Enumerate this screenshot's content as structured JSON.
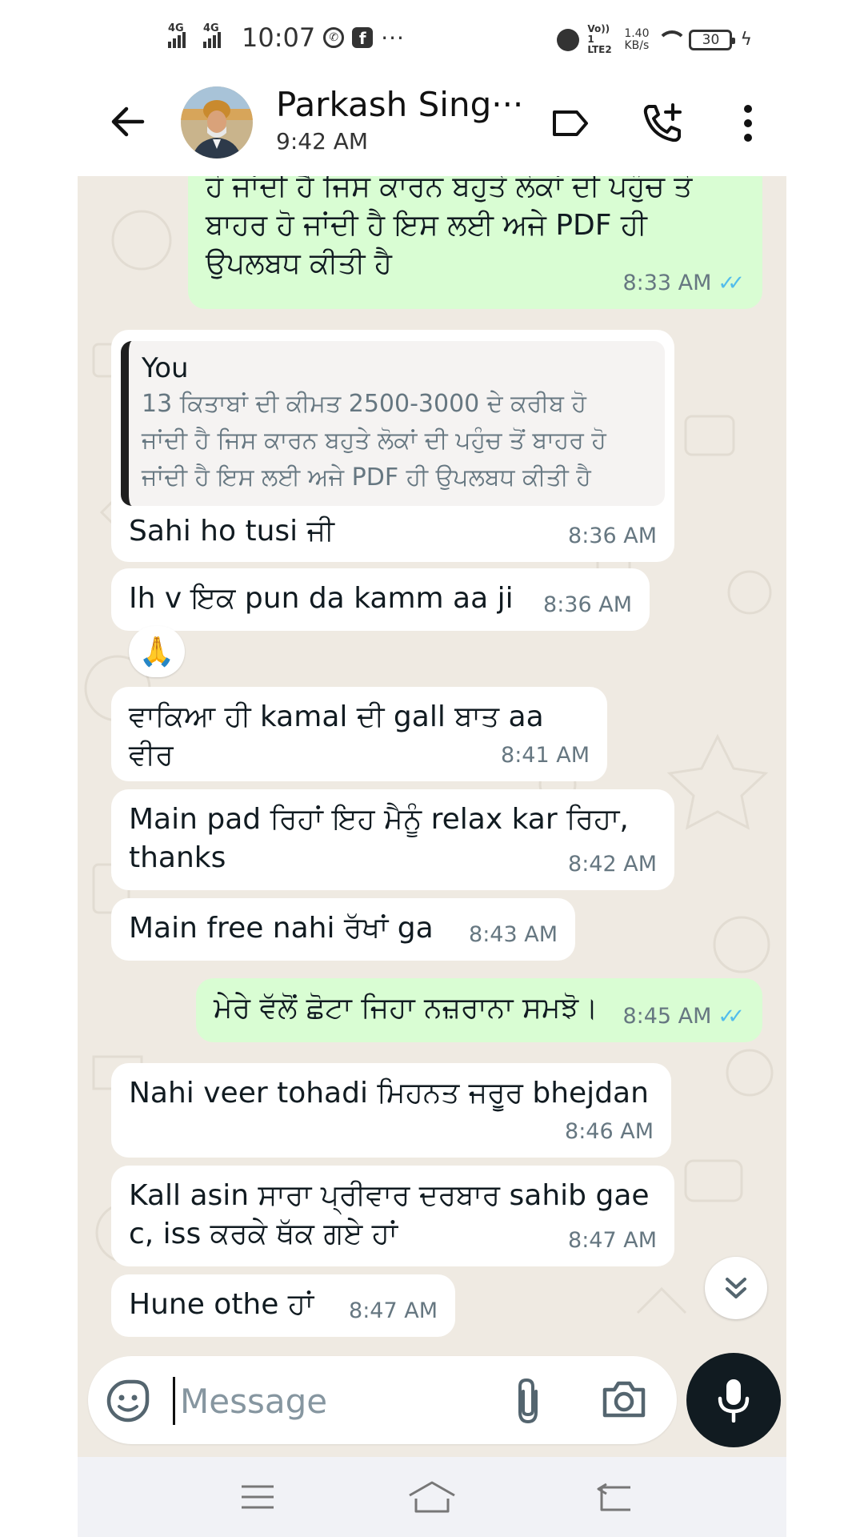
{
  "status_bar": {
    "network_1": "4G",
    "network_2": "4G",
    "time": "10:07",
    "volte": "Vo)) 1 LTE2",
    "speed_value": "1.40",
    "speed_unit": "KB/s",
    "battery": "30"
  },
  "header": {
    "contact_name": "Parkash Sing···",
    "last_seen": "9:42 AM"
  },
  "messages": [
    {
      "direction": "out",
      "text_lines": [
        "ਹੋ ਜਾਂਦੀ ਹੈ ਜਿਸ ਕਾਰਨ ਬਹੁਤੇ ਲੋਕਾਂ ਦੀ ਪਹੁੰਚ ਤੋ",
        "ਬਾਹਰ ਹੋ ਜਾਂਦੀ ਹੈ ਇਸ ਲਈ ਅਜੇ PDF ਹੀ",
        "ਉਪਲਬਧ ਕੀਤੀ ਹੈ"
      ],
      "time": "8:33 AM",
      "read": true
    },
    {
      "direction": "in",
      "quote_author": "You",
      "quote_lines": [
        "13 ਕਿਤਾਬਾਂ ਦੀ ਕੀਮਤ 2500-3000 ਦੇ ਕਰੀਬ ਹੋ",
        "ਜਾਂਦੀ ਹੈ ਜਿਸ ਕਾਰਨ ਬਹੁਤੇ ਲੋਕਾਂ ਦੀ ਪਹੁੰਚ ਤੋਂ ਬਾਹਰ ਹੋ",
        "ਜਾਂਦੀ ਹੈ ਇਸ ਲਈ ਅਜੇ PDF ਹੀ ਉਪਲਬਧ ਕੀਤੀ ਹੈ"
      ],
      "text": "Sahi ho tusi ਜੀ",
      "time": "8:36 AM"
    },
    {
      "direction": "in",
      "text": "Ih v ਇਕ pun da kamm aa ji",
      "time": "8:36 AM",
      "reaction": "🙏"
    },
    {
      "direction": "in",
      "text": "ਵਾਕਿਆ ਹੀ kamal ਦੀ gall ਬਾਤ aa ਵੀਰ",
      "time": "8:41 AM"
    },
    {
      "direction": "in",
      "text_lines": [
        "Main pad ਰਿਹਾਂ ਇਹ ਮੈਨੂੰ relax kar ਰਿਹਾ,",
        "thanks"
      ],
      "time": "8:42 AM"
    },
    {
      "direction": "in",
      "text": "Main free nahi ਰੱਖਾਂ ga",
      "time": "8:43 AM"
    },
    {
      "direction": "out",
      "text": "ਮੇਰੇ ਵੱਲੋਂ ਛੋਟਾ ਜਿਹਾ ਨਜ਼ਰਾਨਾ ਸਮਝੋ।",
      "time": "8:45 AM",
      "read": true
    },
    {
      "direction": "in",
      "text": "Nahi veer tohadi ਮਿਹਨਤ ਜਰੂਰ bhejdan",
      "time": "8:46 AM"
    },
    {
      "direction": "in",
      "text_lines": [
        "Kall asin ਸਾਰਾ ਪ੍ਰੀਵਾਰ ਦਰਬਾਰ sahib gae",
        "c, iss ਕਰਕੇ ਥੱਕ ਗਏ ਹਾਂ"
      ],
      "time": "8:47 AM"
    },
    {
      "direction": "in",
      "text": "Hune othe ਹਾਂ",
      "time": "8:47 AM"
    }
  ],
  "composer": {
    "placeholder": "Message"
  },
  "icons": {
    "back": "arrow-left-icon",
    "label": "label-tag-icon",
    "call": "add-call-icon",
    "menu": "more-vertical-icon",
    "emoji": "sticker-icon",
    "attach": "paperclip-icon",
    "camera": "camera-icon",
    "mic": "microphone-icon",
    "scroll": "double-chevron-down-icon"
  },
  "colors": {
    "chat_bg": "#efeae2",
    "incoming": "#ffffff",
    "outgoing": "#d9fdd3",
    "read_ticks": "#53bdeb",
    "mic_button": "#111b21"
  }
}
